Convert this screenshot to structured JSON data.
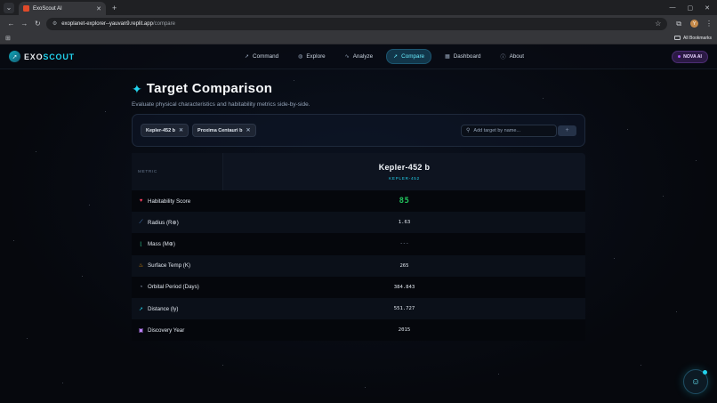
{
  "browser": {
    "tab_title": "ExoScout AI",
    "url_host": "exoplanet-explorer--yauvan9.replit.app",
    "url_path": "/compare",
    "all_bookmarks": "All Bookmarks",
    "profile_initial": "Y"
  },
  "app": {
    "logo_part1": "EXO",
    "logo_part2": "SCOUT",
    "nav": [
      {
        "label": "Command",
        "icon": "rocket-icon"
      },
      {
        "label": "Explore",
        "icon": "globe-icon"
      },
      {
        "label": "Analyze",
        "icon": "activity-icon"
      },
      {
        "label": "Compare",
        "icon": "rocket-icon"
      },
      {
        "label": "Dashboard",
        "icon": "grid-icon"
      },
      {
        "label": "About",
        "icon": "info-icon"
      }
    ],
    "active_nav": "Compare",
    "nova_label": "NOVA AI"
  },
  "page": {
    "title": "Target Comparison",
    "subtitle": "Evaluate physical characteristics and habitability metrics side-by-side."
  },
  "picker": {
    "chips": [
      "Kepler-452 b",
      "Proxima Centauri b"
    ],
    "search_placeholder": "Add target by name...",
    "add_label": "+"
  },
  "table": {
    "metric_header": "METRIC",
    "planet": {
      "name": "Kepler-452 b",
      "host": "KEPLER-452"
    },
    "rows": [
      {
        "metric": "Habitability Score",
        "value": "85",
        "icon": "heart-icon",
        "icon_color": "#f43f5e"
      },
      {
        "metric": "Radius (R⊕)",
        "value": "1.63",
        "icon": "ruler-icon",
        "icon_color": "#60a5fa"
      },
      {
        "metric": "Mass (M⊕)",
        "value": "---",
        "icon": "scale-icon",
        "icon_color": "#34d399"
      },
      {
        "metric": "Surface Temp (K)",
        "value": "265",
        "icon": "thermometer-icon",
        "icon_color": "#f59e0b"
      },
      {
        "metric": "Orbital Period (Days)",
        "value": "384.843",
        "icon": "orbit-icon",
        "icon_color": "#94a3b8"
      },
      {
        "metric": "Distance (ly)",
        "value": "551.727",
        "icon": "rocket-icon",
        "icon_color": "#22d3ee"
      },
      {
        "metric": "Discovery Year",
        "value": "2015",
        "icon": "calendar-icon",
        "icon_color": "#c084fc"
      }
    ]
  },
  "colors": {
    "accent": "#22d3ee",
    "score": "#22c55e",
    "nova": "#a855f7"
  }
}
